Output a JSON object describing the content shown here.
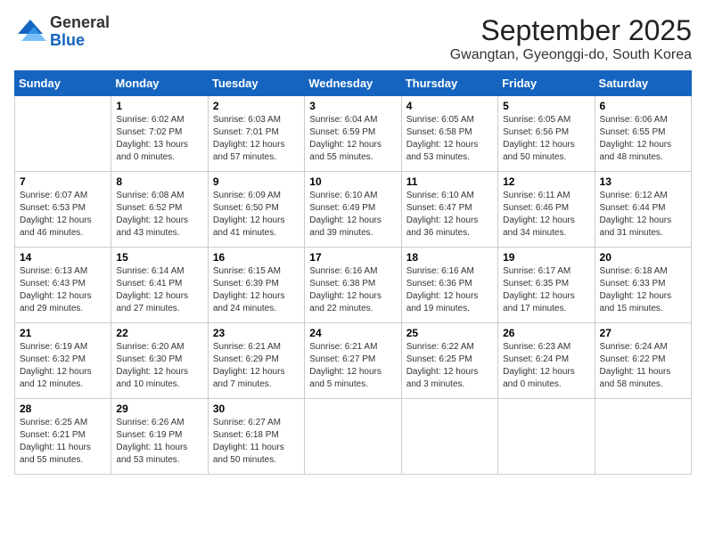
{
  "logo": {
    "general": "General",
    "blue": "Blue"
  },
  "title": "September 2025",
  "subtitle": "Gwangtan, Gyeonggi-do, South Korea",
  "days_of_week": [
    "Sunday",
    "Monday",
    "Tuesday",
    "Wednesday",
    "Thursday",
    "Friday",
    "Saturday"
  ],
  "weeks": [
    [
      {
        "day": "",
        "info": ""
      },
      {
        "day": "1",
        "info": "Sunrise: 6:02 AM\nSunset: 7:02 PM\nDaylight: 13 hours\nand 0 minutes."
      },
      {
        "day": "2",
        "info": "Sunrise: 6:03 AM\nSunset: 7:01 PM\nDaylight: 12 hours\nand 57 minutes."
      },
      {
        "day": "3",
        "info": "Sunrise: 6:04 AM\nSunset: 6:59 PM\nDaylight: 12 hours\nand 55 minutes."
      },
      {
        "day": "4",
        "info": "Sunrise: 6:05 AM\nSunset: 6:58 PM\nDaylight: 12 hours\nand 53 minutes."
      },
      {
        "day": "5",
        "info": "Sunrise: 6:05 AM\nSunset: 6:56 PM\nDaylight: 12 hours\nand 50 minutes."
      },
      {
        "day": "6",
        "info": "Sunrise: 6:06 AM\nSunset: 6:55 PM\nDaylight: 12 hours\nand 48 minutes."
      }
    ],
    [
      {
        "day": "7",
        "info": "Sunrise: 6:07 AM\nSunset: 6:53 PM\nDaylight: 12 hours\nand 46 minutes."
      },
      {
        "day": "8",
        "info": "Sunrise: 6:08 AM\nSunset: 6:52 PM\nDaylight: 12 hours\nand 43 minutes."
      },
      {
        "day": "9",
        "info": "Sunrise: 6:09 AM\nSunset: 6:50 PM\nDaylight: 12 hours\nand 41 minutes."
      },
      {
        "day": "10",
        "info": "Sunrise: 6:10 AM\nSunset: 6:49 PM\nDaylight: 12 hours\nand 39 minutes."
      },
      {
        "day": "11",
        "info": "Sunrise: 6:10 AM\nSunset: 6:47 PM\nDaylight: 12 hours\nand 36 minutes."
      },
      {
        "day": "12",
        "info": "Sunrise: 6:11 AM\nSunset: 6:46 PM\nDaylight: 12 hours\nand 34 minutes."
      },
      {
        "day": "13",
        "info": "Sunrise: 6:12 AM\nSunset: 6:44 PM\nDaylight: 12 hours\nand 31 minutes."
      }
    ],
    [
      {
        "day": "14",
        "info": "Sunrise: 6:13 AM\nSunset: 6:43 PM\nDaylight: 12 hours\nand 29 minutes."
      },
      {
        "day": "15",
        "info": "Sunrise: 6:14 AM\nSunset: 6:41 PM\nDaylight: 12 hours\nand 27 minutes."
      },
      {
        "day": "16",
        "info": "Sunrise: 6:15 AM\nSunset: 6:39 PM\nDaylight: 12 hours\nand 24 minutes."
      },
      {
        "day": "17",
        "info": "Sunrise: 6:16 AM\nSunset: 6:38 PM\nDaylight: 12 hours\nand 22 minutes."
      },
      {
        "day": "18",
        "info": "Sunrise: 6:16 AM\nSunset: 6:36 PM\nDaylight: 12 hours\nand 19 minutes."
      },
      {
        "day": "19",
        "info": "Sunrise: 6:17 AM\nSunset: 6:35 PM\nDaylight: 12 hours\nand 17 minutes."
      },
      {
        "day": "20",
        "info": "Sunrise: 6:18 AM\nSunset: 6:33 PM\nDaylight: 12 hours\nand 15 minutes."
      }
    ],
    [
      {
        "day": "21",
        "info": "Sunrise: 6:19 AM\nSunset: 6:32 PM\nDaylight: 12 hours\nand 12 minutes."
      },
      {
        "day": "22",
        "info": "Sunrise: 6:20 AM\nSunset: 6:30 PM\nDaylight: 12 hours\nand 10 minutes."
      },
      {
        "day": "23",
        "info": "Sunrise: 6:21 AM\nSunset: 6:29 PM\nDaylight: 12 hours\nand 7 minutes."
      },
      {
        "day": "24",
        "info": "Sunrise: 6:21 AM\nSunset: 6:27 PM\nDaylight: 12 hours\nand 5 minutes."
      },
      {
        "day": "25",
        "info": "Sunrise: 6:22 AM\nSunset: 6:25 PM\nDaylight: 12 hours\nand 3 minutes."
      },
      {
        "day": "26",
        "info": "Sunrise: 6:23 AM\nSunset: 6:24 PM\nDaylight: 12 hours\nand 0 minutes."
      },
      {
        "day": "27",
        "info": "Sunrise: 6:24 AM\nSunset: 6:22 PM\nDaylight: 11 hours\nand 58 minutes."
      }
    ],
    [
      {
        "day": "28",
        "info": "Sunrise: 6:25 AM\nSunset: 6:21 PM\nDaylight: 11 hours\nand 55 minutes."
      },
      {
        "day": "29",
        "info": "Sunrise: 6:26 AM\nSunset: 6:19 PM\nDaylight: 11 hours\nand 53 minutes."
      },
      {
        "day": "30",
        "info": "Sunrise: 6:27 AM\nSunset: 6:18 PM\nDaylight: 11 hours\nand 50 minutes."
      },
      {
        "day": "",
        "info": ""
      },
      {
        "day": "",
        "info": ""
      },
      {
        "day": "",
        "info": ""
      },
      {
        "day": "",
        "info": ""
      }
    ]
  ]
}
